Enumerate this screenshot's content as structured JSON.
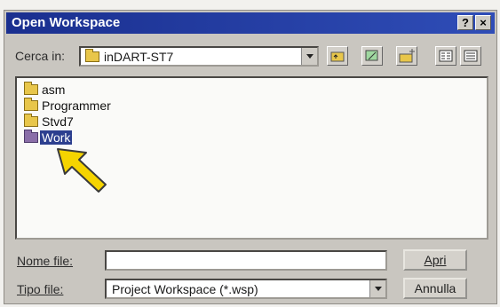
{
  "window": {
    "title": "Open Workspace",
    "help_label": "?",
    "close_label": "×"
  },
  "look_in": {
    "label": "Cerca in:",
    "value": "inDART-ST7"
  },
  "toolbar": {
    "icons": [
      "up-folder-icon",
      "desktop-icon",
      "new-folder-icon",
      "list-view-icon",
      "details-view-icon"
    ]
  },
  "file_list": {
    "items": [
      {
        "name": "asm",
        "selected": false
      },
      {
        "name": "Programmer",
        "selected": false
      },
      {
        "name": "Stvd7",
        "selected": false
      },
      {
        "name": "Work",
        "selected": true
      }
    ]
  },
  "file_name": {
    "label": "Nome file:",
    "value": ""
  },
  "file_type": {
    "label": "Tipo file:",
    "value": "Project Workspace (*.wsp)"
  },
  "buttons": {
    "open": "Apri",
    "cancel": "Annulla"
  },
  "annotation": {
    "icon": "pointer-arrow-icon",
    "color": "#f5d400"
  }
}
